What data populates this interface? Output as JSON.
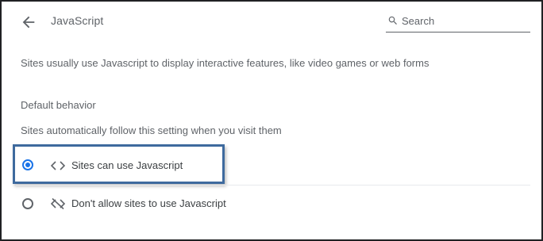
{
  "header": {
    "title": "JavaScript",
    "back_icon": "arrow-back-icon",
    "search": {
      "placeholder": "Search",
      "value": "",
      "icon": "search-icon"
    }
  },
  "description": "Sites usually use Javascript to display interactive features, like video games or web forms",
  "default_behavior": {
    "heading": "Default behavior",
    "subtitle": "Sites automatically follow this setting when you visit them",
    "options": [
      {
        "label": "Sites can use Javascript",
        "icon": "code-icon",
        "selected": true,
        "highlighted": true
      },
      {
        "label": "Don't allow sites to use Javascript",
        "icon": "code-off-icon",
        "selected": false,
        "highlighted": false
      }
    ]
  },
  "colors": {
    "accent": "#1a73e8",
    "text_secondary": "#5f6368",
    "text_primary": "#3c4043",
    "highlight_border": "#3e6a9e",
    "frame_border": "#202124"
  }
}
